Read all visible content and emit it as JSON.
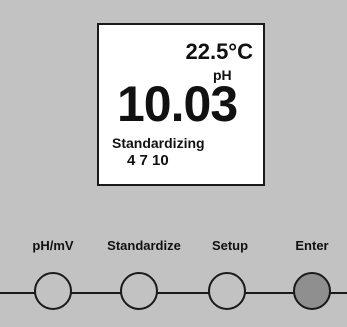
{
  "display": {
    "temperature": "22.5°C",
    "unit": "pH",
    "reading": "10.03",
    "mode": "Standardizing",
    "buffers": "4 7 10"
  },
  "buttons": [
    {
      "label": "pH/mV",
      "active": false
    },
    {
      "label": "Standardize",
      "active": false
    },
    {
      "label": "Setup",
      "active": false
    },
    {
      "label": "Enter",
      "active": true
    }
  ],
  "colors": {
    "background": "#c2c2c2",
    "screen": "#ffffff",
    "enter_button": "#8f8f8f"
  }
}
